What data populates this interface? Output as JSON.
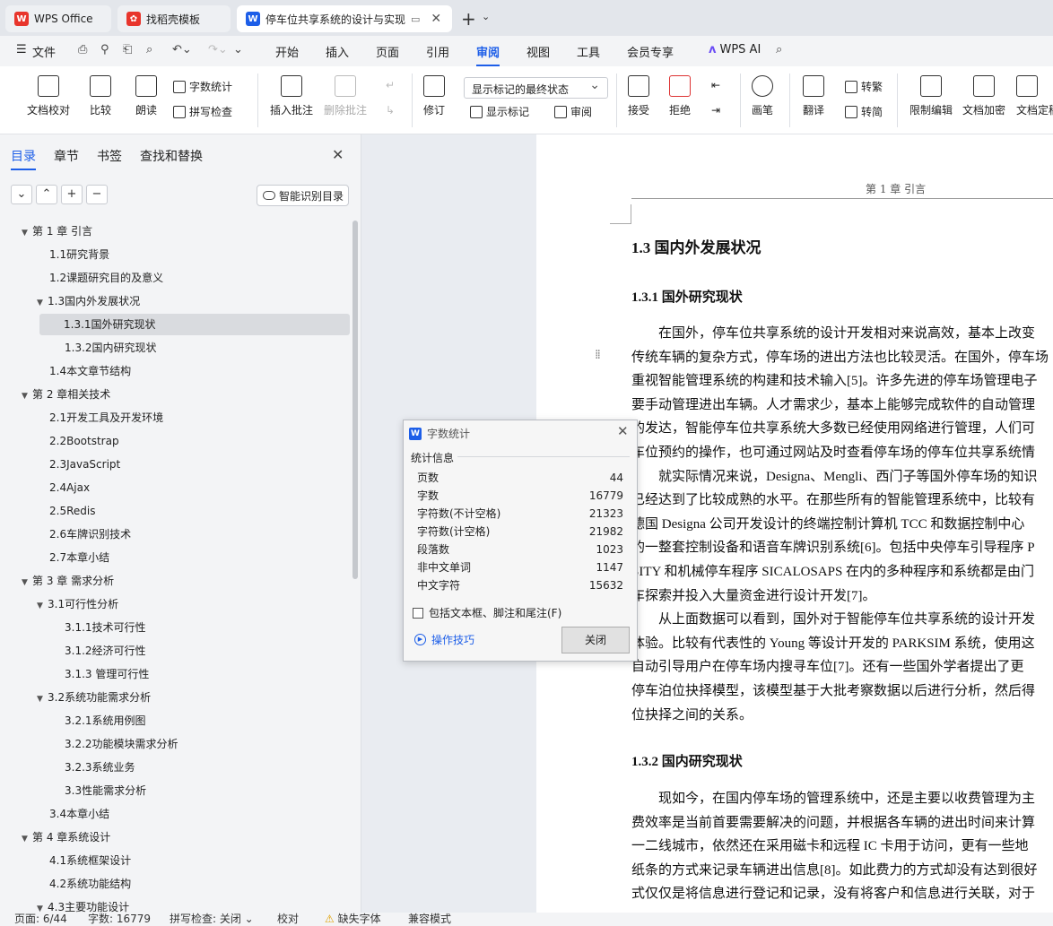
{
  "tabs": [
    {
      "label": "WPS Office",
      "icon": "wps-logo-icon"
    },
    {
      "label": "找稻壳模板",
      "icon": "docer-icon"
    },
    {
      "label": "停车位共享系统的设计与实现",
      "icon": "word-doc-icon"
    }
  ],
  "menu": {
    "file": "文件",
    "items": [
      "开始",
      "插入",
      "页面",
      "引用",
      "审阅",
      "视图",
      "工具",
      "会员专享"
    ],
    "active": "审阅",
    "ai": "WPS AI"
  },
  "ribbon": {
    "doc_proofread": "文档校对",
    "compare": "比较",
    "read_aloud": "朗读",
    "word_count": "字数统计",
    "spell_check": "拼写检查",
    "insert_comment": "插入批注",
    "delete_comment": "删除批注",
    "track": "修订",
    "markup_dropdown": "显示标记的最终状态",
    "show_markup": "显示标记",
    "review": "审阅",
    "accept": "接受",
    "reject": "拒绝",
    "pen": "画笔",
    "translate": "翻译",
    "to_traditional": "转繁",
    "to_simplified": "转简",
    "restrict_edit": "限制编辑",
    "encrypt": "文档加密",
    "finalize": "文档定稿"
  },
  "sidebar": {
    "tabs": [
      "目录",
      "章节",
      "书签",
      "查找和替换"
    ],
    "active_tab": "目录",
    "smart_toc": "智能识别目录",
    "toc": [
      {
        "label": "第 1 章 引言",
        "level": 1,
        "expanded": true
      },
      {
        "label": "1.1研究背景",
        "level": 2
      },
      {
        "label": "1.2课题研究目的及意义",
        "level": 2
      },
      {
        "label": "1.3国内外发展状况",
        "level": 2,
        "expanded": true
      },
      {
        "label": "1.3.1国外研究现状",
        "level": 3,
        "selected": true
      },
      {
        "label": "1.3.2国内研究现状",
        "level": 3
      },
      {
        "label": "1.4本文章节结构",
        "level": 2
      },
      {
        "label": "第 2 章相关技术",
        "level": 1,
        "expanded": true
      },
      {
        "label": "2.1开发工具及开发环境",
        "level": 2
      },
      {
        "label": "2.2Bootstrap",
        "level": 2
      },
      {
        "label": "2.3JavaScript",
        "level": 2
      },
      {
        "label": "2.4Ajax",
        "level": 2
      },
      {
        "label": "2.5Redis",
        "level": 2
      },
      {
        "label": "2.6车牌识别技术",
        "level": 2
      },
      {
        "label": "2.7本章小结",
        "level": 2
      },
      {
        "label": "第 3 章 需求分析",
        "level": 1,
        "expanded": true
      },
      {
        "label": "3.1可行性分析",
        "level": 2,
        "expanded": true
      },
      {
        "label": "3.1.1技术可行性",
        "level": 3
      },
      {
        "label": "3.1.2经济可行性",
        "level": 3
      },
      {
        "label": "3.1.3  管理可行性",
        "level": 3
      },
      {
        "label": "3.2系统功能需求分析",
        "level": 2,
        "expanded": true
      },
      {
        "label": "3.2.1系统用例图",
        "level": 3
      },
      {
        "label": "3.2.2功能模块需求分析",
        "level": 3
      },
      {
        "label": "3.2.3系统业务",
        "level": 3
      },
      {
        "label": "3.3性能需求分析",
        "level": 3
      },
      {
        "label": "3.4本章小结",
        "level": 2
      },
      {
        "label": "第 4 章系统设计",
        "level": 1,
        "expanded": true
      },
      {
        "label": "4.1系统框架设计",
        "level": 2
      },
      {
        "label": "4.2系统功能结构",
        "level": 2
      },
      {
        "label": "4.3主要功能设计",
        "level": 2,
        "expanded": true
      }
    ]
  },
  "document": {
    "header": "第 1 章  引言",
    "h2": "1.3  国内外发展状况",
    "h3a": "1.3.1  国外研究现状",
    "para1": [
      "　　在国外，停车位共享系统的设计开发相对来说高效，基本上改变",
      "传统车辆的复杂方式，停车场的进出方法也比较灵活。在国外，停车场",
      "重视智能管理系统的构建和技术输入[5]。许多先进的停车场管理电子",
      "要手动管理进出车辆。人才需求少，基本上能够完成软件的自动管理",
      "的发达，智能停车位共享系统大多数已经使用网络进行管理，人们可",
      "车位预约的操作，也可通过网站及时查看停车场的停车位共享系统情"
    ],
    "para2": [
      "　　就实际情况来说，Designa、Mengli、西门子等国外停车场的知识",
      "已经达到了比较成熟的水平。在那些所有的智能管理系统中，比较有",
      "德国 Designa 公司开发设计的终端控制计算机 TCC 和数据控制中心",
      "的一整套控制设备和语音车牌识别系统[6]。包括中央停车引导程序 P",
      "SITY 和机械停车程序 SICALOSAPS 在内的多种程序和系统都是由门",
      "车探索并投入大量资金进行设计开发[7]。"
    ],
    "para3": [
      "　　从上面数据可以看到，国外对于智能停车位共享系统的设计开发",
      "体验。比较有代表性的 Young 等设计开发的 PARKSIM 系统，使用这",
      "自动引导用户在停车场内搜寻车位[7]。还有一些国外学者提出了更",
      "停车泊位抉择模型，该模型基于大批考察数据以后进行分析，然后得",
      "位抉择之间的关系。"
    ],
    "h3b": "1.3.2  国内研究现状",
    "para4": [
      "　　现如今，在国内停车场的管理系统中，还是主要以收费管理为主",
      "费效率是当前首要需要解决的问题，并根据各车辆的进出时间来计算",
      "一二线城市，依然还在采用磁卡和远程 IC 卡用于访问，更有一些地",
      "纸条的方式来记录车辆进出信息[8]。如此费力的方式却没有达到很好",
      "式仅仅是将信息进行登记和记录，没有将客户和信息进行关联，对于"
    ]
  },
  "dialog": {
    "title": "字数统计",
    "section": "统计信息",
    "rows": [
      {
        "label": "页数",
        "value": "44"
      },
      {
        "label": "字数",
        "value": "16779"
      },
      {
        "label": "字符数(不计空格)",
        "value": "21323"
      },
      {
        "label": "字符数(计空格)",
        "value": "21982"
      },
      {
        "label": "段落数",
        "value": "1023"
      },
      {
        "label": "非中文单词",
        "value": "1147"
      },
      {
        "label": "中文字符",
        "value": "15632"
      }
    ],
    "include_label": "包括文本框、脚注和尾注(F)",
    "tips": "操作技巧",
    "close": "关闭"
  },
  "status": {
    "page": "页面: 6/44",
    "words": "字数: 16779",
    "spell": "拼写检查: 关闭",
    "proofread": "校对",
    "missing_font": "缺失字体",
    "compat": "兼容模式"
  },
  "colors": {
    "accent": "#1d5ee8",
    "wps_red": "#e8352c"
  }
}
